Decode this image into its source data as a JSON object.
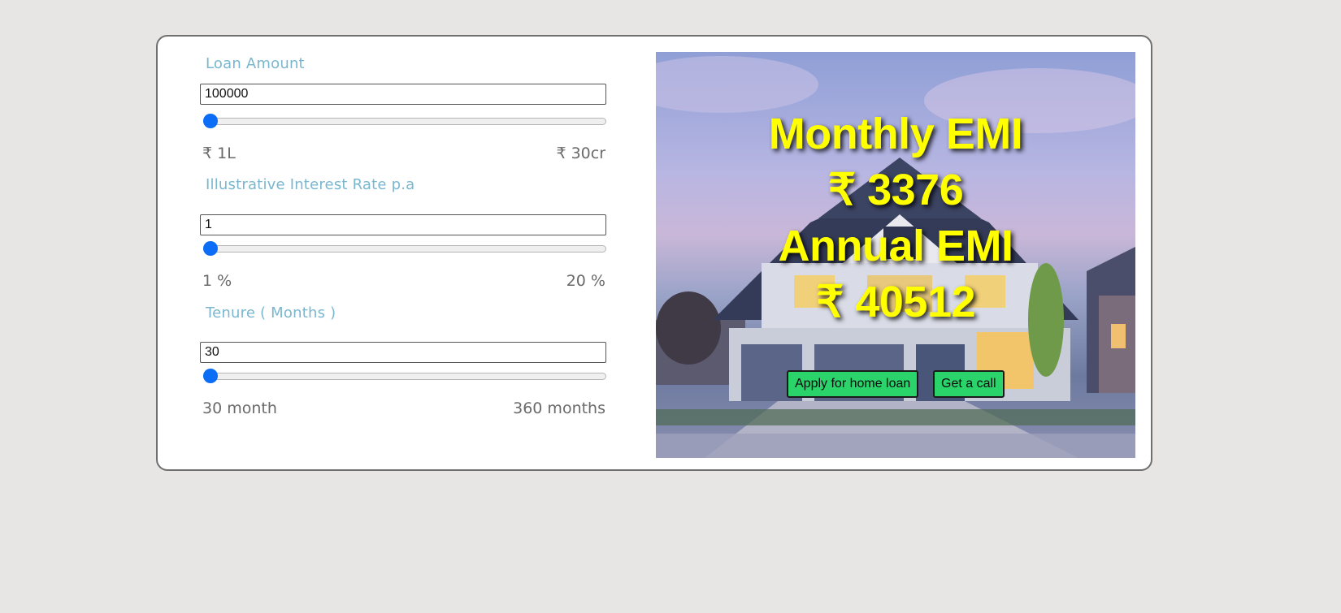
{
  "loan_amount": {
    "label": "Loan Amount",
    "value": "100000",
    "slider_fraction": 0.0,
    "min_label": "₹ 1L",
    "max_label": "₹ 30cr"
  },
  "interest_rate": {
    "label": "Illustrative Interest Rate p.a",
    "value": "1",
    "slider_fraction": 0.0,
    "min_label": "1 %",
    "max_label": "20 %"
  },
  "tenure": {
    "label": "Tenure ( Months )",
    "value": "30",
    "slider_fraction": 0.0,
    "min_label": "30 month",
    "max_label": "360 months"
  },
  "result": {
    "monthly_label": "Monthly EMI",
    "monthly_value": "₹ 3376",
    "annual_label": "Annual EMI",
    "annual_value": "₹ 40512"
  },
  "actions": {
    "apply_label": "Apply for home loan",
    "call_label": "Get a call"
  },
  "colors": {
    "label_accent": "#7ab7cf",
    "emi_text": "#ffff00",
    "button_bg": "#2bd46b",
    "slider_thumb": "#0b6cf6"
  }
}
